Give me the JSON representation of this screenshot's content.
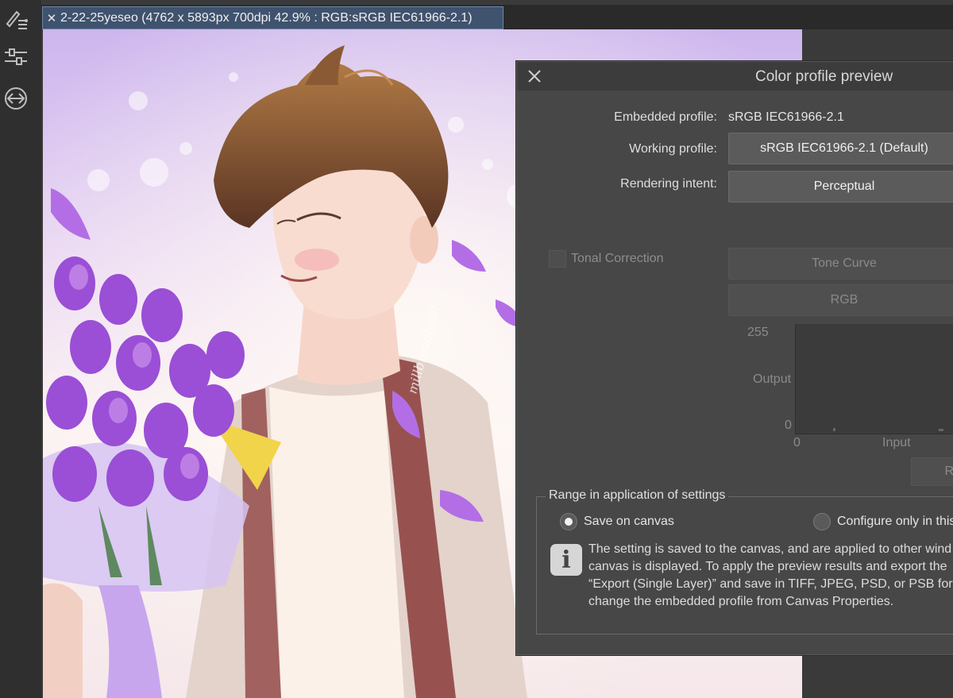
{
  "toolbar": {
    "icons": [
      "brush-settings-icon",
      "sliders-icon",
      "transfer-icon"
    ]
  },
  "tab": {
    "close_glyph": "✕",
    "title": "2-22-25yeseo (4762 x 5893px 700dpi 42.9% : RGB:sRGB IEC61966-2.1)"
  },
  "artwork": {
    "signature": "millbreadless!"
  },
  "dialog": {
    "title": "Color profile preview",
    "embedded_profile_label": "Embedded profile:",
    "embedded_profile_value": "sRGB IEC61966-2.1",
    "working_profile_label": "Working profile:",
    "working_profile_value": "sRGB IEC61966-2.1 (Default)",
    "rendering_intent_label": "Rendering intent:",
    "rendering_intent_value": "Perceptual",
    "tonal_correction_label": "Tonal Correction",
    "tone_curve_label": "Tone Curve",
    "channel_label": "RGB",
    "graph": {
      "y_max": "255",
      "y_min": "0",
      "y_label": "Output",
      "x_min": "0",
      "x_label": "Input"
    },
    "reset_button_partial": "Re",
    "range": {
      "legend": "Range in application of settings",
      "option_save": "Save on canvas",
      "option_configure": "Configure only in this",
      "selected": "Save on canvas"
    },
    "info_text": [
      "The setting is saved to the canvas, and are applied to other wind",
      "canvas is displayed. To apply the preview results and export the",
      "“Export (Single Layer)” and save in TIFF, JPEG, PSD, or PSB form",
      "change the embedded profile from Canvas Properties."
    ]
  },
  "colors": {
    "tab_active": "#3f526e",
    "dialog_bg": "#474747",
    "app_bg": "#2b2b2b"
  }
}
